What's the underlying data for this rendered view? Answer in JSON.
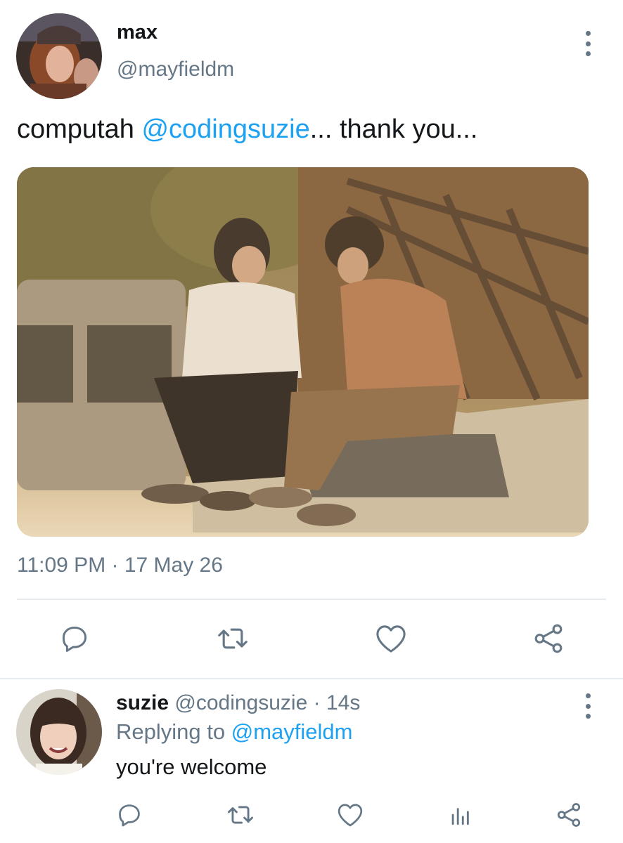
{
  "main_tweet": {
    "author_name": "max",
    "author_handle": "@mayfieldm",
    "text_before": "computah ",
    "text_mention": "@codingsuzie",
    "text_after": "... thank you...",
    "timestamp": "11:09 PM · 17 May 26",
    "actions": [
      "reply-icon",
      "retweet-icon",
      "like-icon",
      "share-icon"
    ]
  },
  "reply_tweet": {
    "author_name": "suzie",
    "author_handle": "@codingsuzie",
    "separator": " · ",
    "time": "14s",
    "replying_prefix": "Replying to ",
    "replying_mention": "@mayfieldm",
    "text": "you're welcome",
    "actions": [
      "reply-icon",
      "retweet-icon",
      "like-icon",
      "analytics-icon",
      "share-icon"
    ]
  },
  "colors": {
    "accent": "#1da1f2",
    "secondary_text": "#657786",
    "primary_text": "#14171a",
    "divider": "#e6ecf0"
  }
}
